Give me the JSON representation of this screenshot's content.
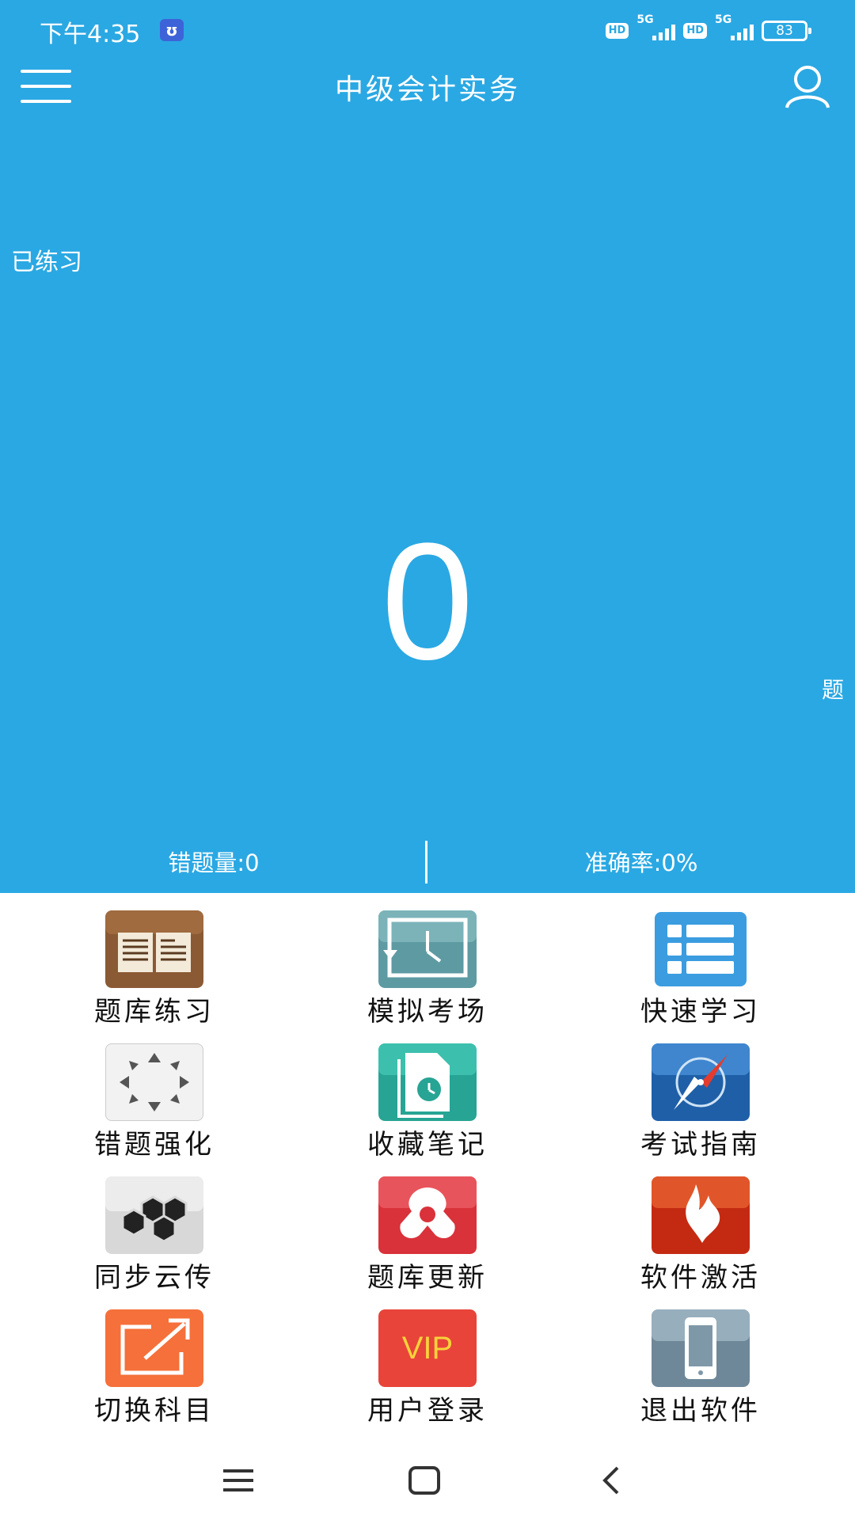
{
  "status_bar": {
    "time": "下午4:35",
    "notif_glyph": "ʊ",
    "hd1": "HD",
    "net1": "5G",
    "hd2": "HD",
    "net2": "5G",
    "battery": "83"
  },
  "header": {
    "title": "中级会计实务"
  },
  "stats": {
    "practiced_label": "已练习",
    "practiced_count": "0",
    "unit": "题",
    "wrong_count": "错题量:0",
    "accuracy": "准确率:0%"
  },
  "menu": [
    {
      "label": "题库练习",
      "icon": "book-icon"
    },
    {
      "label": "模拟考场",
      "icon": "clock-icon"
    },
    {
      "label": "快速学习",
      "icon": "list-icon"
    },
    {
      "label": "错题强化",
      "icon": "arrows-icon"
    },
    {
      "label": "收藏笔记",
      "icon": "document-clock-icon"
    },
    {
      "label": "考试指南",
      "icon": "compass-icon"
    },
    {
      "label": "同步云传",
      "icon": "hexagon-icon"
    },
    {
      "label": "题库更新",
      "icon": "update-icon"
    },
    {
      "label": "软件激活",
      "icon": "flame-icon"
    },
    {
      "label": "切换科目",
      "icon": "switch-icon"
    },
    {
      "label": "用户登录",
      "icon": "vip-icon",
      "icon_text": "VIP"
    },
    {
      "label": "退出软件",
      "icon": "phone-icon"
    }
  ],
  "colors": {
    "primary": "#2aa8e3"
  }
}
